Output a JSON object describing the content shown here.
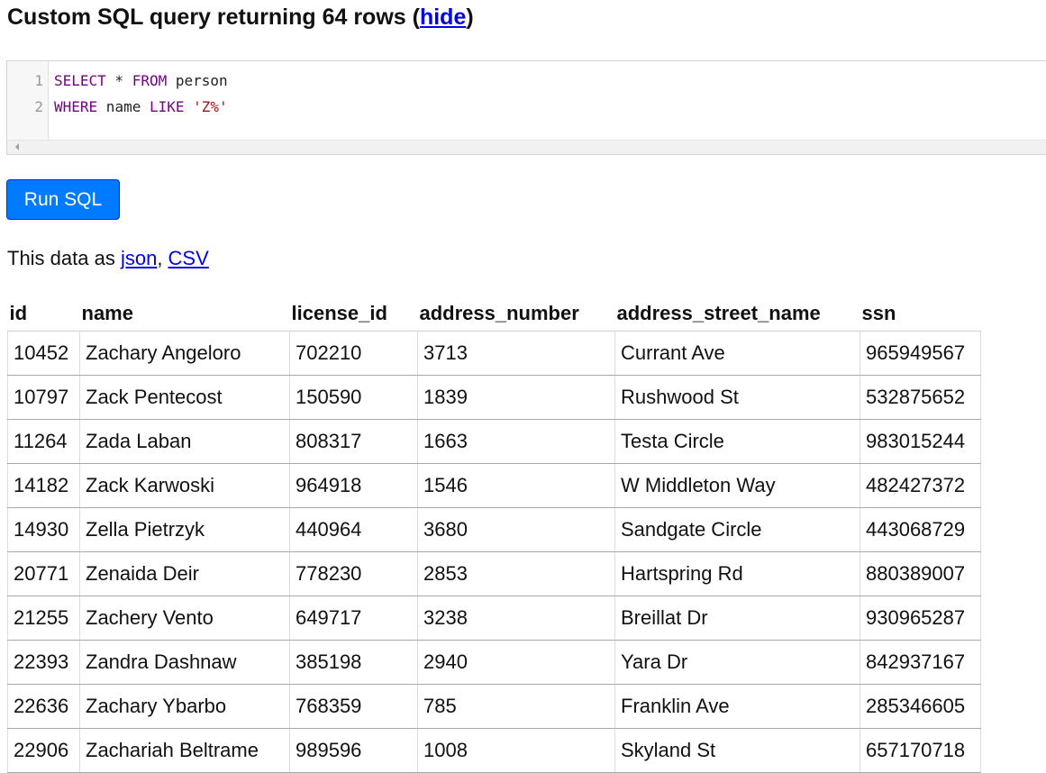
{
  "heading": {
    "prefix": "Custom SQL query returning 64 rows (",
    "link": "hide",
    "suffix": ")"
  },
  "editor": {
    "lines": [
      {
        "number": "1",
        "tokens": [
          {
            "text": "SELECT",
            "kind": "keyword"
          },
          {
            "text": " * ",
            "kind": "plain"
          },
          {
            "text": "FROM",
            "kind": "keyword"
          },
          {
            "text": " person",
            "kind": "plain"
          }
        ]
      },
      {
        "number": "2",
        "tokens": [
          {
            "text": "WHERE",
            "kind": "keyword"
          },
          {
            "text": " name ",
            "kind": "plain"
          },
          {
            "text": "LIKE",
            "kind": "keyword"
          },
          {
            "text": " ",
            "kind": "plain"
          },
          {
            "text": "'Z%'",
            "kind": "string"
          }
        ]
      }
    ]
  },
  "run_button": "Run SQL",
  "export": {
    "prefix": "This data as ",
    "json_label": "json",
    "separator": ", ",
    "csv_label": "CSV"
  },
  "table": {
    "columns": [
      "id",
      "name",
      "license_id",
      "address_number",
      "address_street_name",
      "ssn"
    ],
    "rows": [
      [
        "10452",
        "Zachary Angeloro",
        "702210",
        "3713",
        "Currant Ave",
        "965949567"
      ],
      [
        "10797",
        "Zack Pentecost",
        "150590",
        "1839",
        "Rushwood St",
        "532875652"
      ],
      [
        "11264",
        "Zada Laban",
        "808317",
        "1663",
        "Testa Circle",
        "983015244"
      ],
      [
        "14182",
        "Zack Karwoski",
        "964918",
        "1546",
        "W Middleton Way",
        "482427372"
      ],
      [
        "14930",
        "Zella Pietrzyk",
        "440964",
        "3680",
        "Sandgate Circle",
        "443068729"
      ],
      [
        "20771",
        "Zenaida Deir",
        "778230",
        "2853",
        "Hartspring Rd",
        "880389007"
      ],
      [
        "21255",
        "Zachery Vento",
        "649717",
        "3238",
        "Breillat Dr",
        "930965287"
      ],
      [
        "22393",
        "Zandra Dashnaw",
        "385198",
        "2940",
        "Yara Dr",
        "842937167"
      ],
      [
        "22636",
        "Zachary Ybarbo",
        "768359",
        "785",
        "Franklin Ave",
        "285346605"
      ],
      [
        "22906",
        "Zachariah Beltrame",
        "989596",
        "1008",
        "Skyland St",
        "657170718"
      ]
    ]
  },
  "colors": {
    "link": "#0000ee",
    "button": "#007bff",
    "sql_keyword": "#770088",
    "sql_string": "#aa1111"
  }
}
